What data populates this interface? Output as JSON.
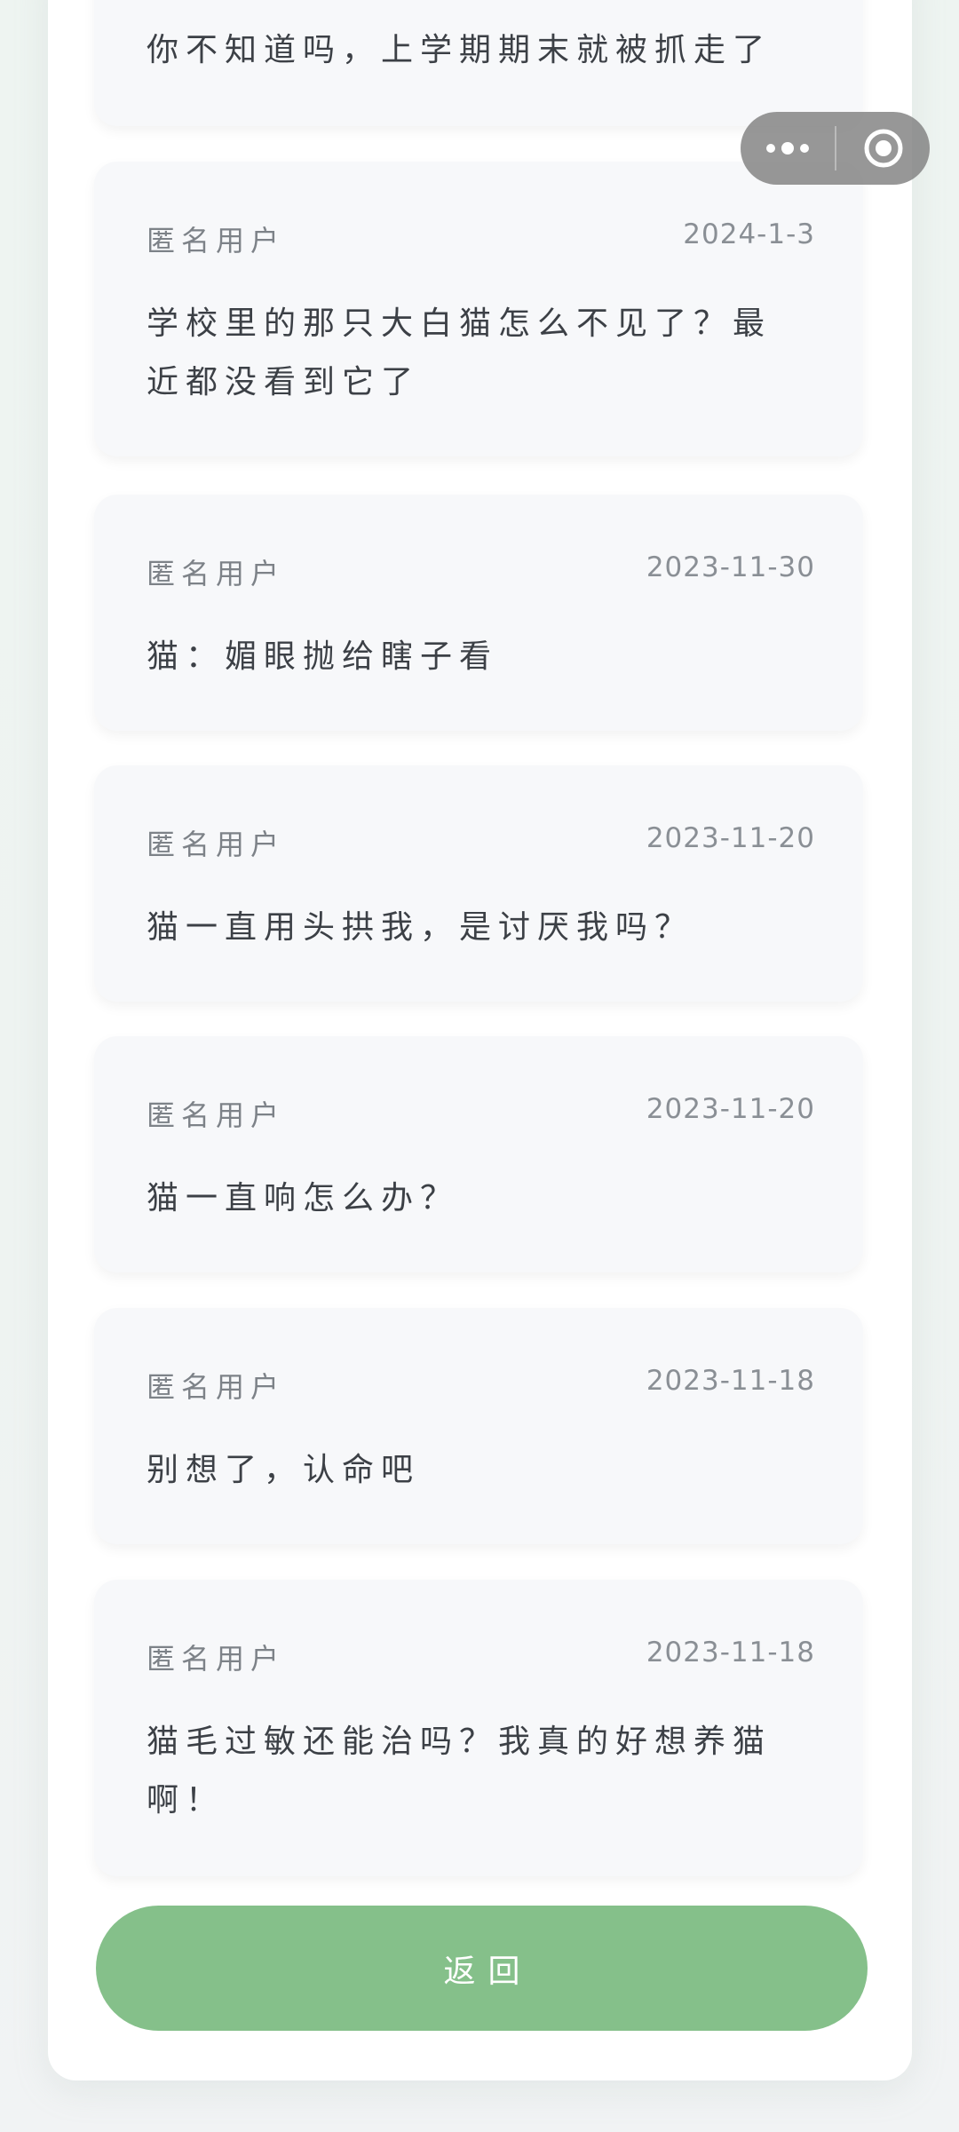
{
  "nav": {
    "more_icon": "more-dots-icon",
    "close_icon": "target-close-icon"
  },
  "posts": [
    {
      "user": "",
      "date": "",
      "text": "你不知道吗，上学期期末就被抓走了"
    },
    {
      "user": "匿名用户",
      "date": "2024-1-3",
      "text": "学校里的那只大白猫怎么不见了？最近都没看到它了"
    },
    {
      "user": "匿名用户",
      "date": "2023-11-30",
      "text": "猫：媚眼抛给瞎子看"
    },
    {
      "user": "匿名用户",
      "date": "2023-11-20",
      "text": "猫一直用头拱我，是讨厌我吗？"
    },
    {
      "user": "匿名用户",
      "date": "2023-11-20",
      "text": "猫一直响怎么办？"
    },
    {
      "user": "匿名用户",
      "date": "2023-11-18",
      "text": "别想了，认命吧"
    },
    {
      "user": "匿名用户",
      "date": "2023-11-18",
      "text": "猫毛过敏还能治吗？我真的好想养猫啊！"
    }
  ],
  "footer": {
    "back_label": "返回"
  }
}
